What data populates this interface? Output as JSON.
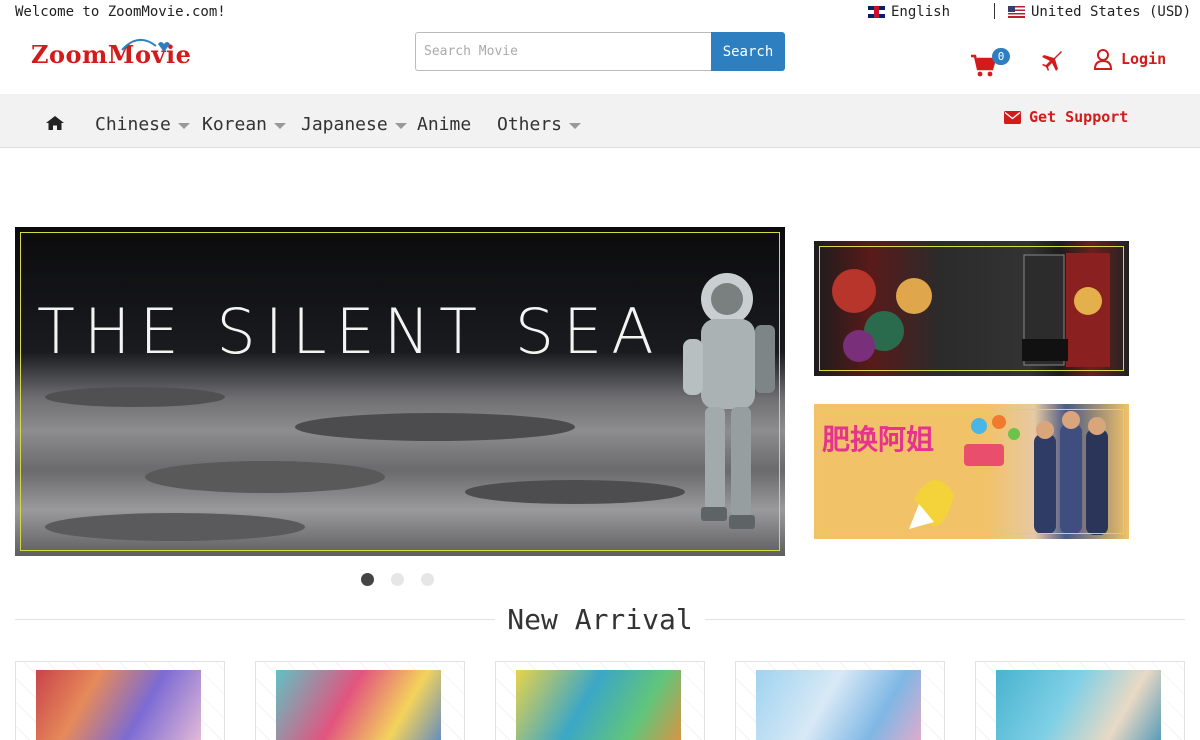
{
  "topbar": {
    "welcome": "Welcome to ZoomMovie.com!",
    "language": "English",
    "country": "United States (USD)"
  },
  "header": {
    "logo": "ZoomMovie",
    "search_placeholder": "Search Movie",
    "search_button": "Search",
    "cart_count": "0",
    "login": "Login"
  },
  "nav": {
    "items": [
      {
        "label": "Chinese",
        "dropdown": true
      },
      {
        "label": "Korean",
        "dropdown": true
      },
      {
        "label": "Japanese",
        "dropdown": true
      },
      {
        "label": "Anime",
        "dropdown": false
      },
      {
        "label": "Others",
        "dropdown": true
      }
    ],
    "support": "Get Support"
  },
  "hero": {
    "title": "THE SILENT SEA",
    "slides": 3,
    "active_slide": 1
  },
  "side_banners": [
    {
      "name": "demon-slayer-banner"
    },
    {
      "name": "variety-show-banner",
      "text": "肥换阿姐"
    }
  ],
  "section": {
    "title": "New Arrival"
  },
  "colors": {
    "brand_red": "#d21b1b",
    "accent_blue": "#2e7fbf",
    "nav_bg": "#f2f2f2"
  }
}
